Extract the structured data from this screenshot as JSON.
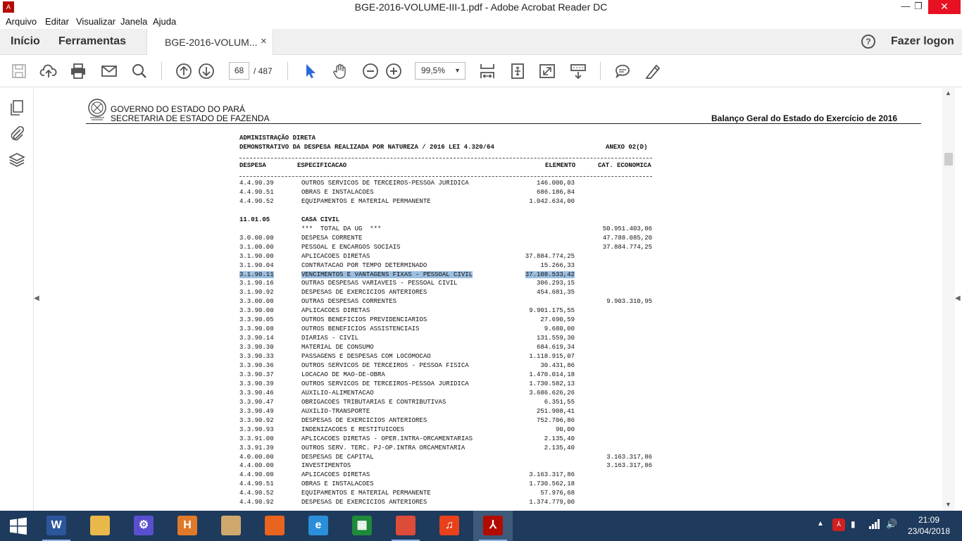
{
  "window": {
    "title": "BGE-2016-VOLUME-III-1.pdf - Adobe Acrobat Reader DC",
    "controls": {
      "minimize": "—",
      "maximize": "❐",
      "close": "✕"
    }
  },
  "menu": [
    "Arquivo",
    "Editar",
    "Visualizar",
    "Janela",
    "Ajuda"
  ],
  "tabs": {
    "home": "Início",
    "tools": "Ferramentas",
    "document": "BGE-2016-VOLUM...",
    "document_close": "×",
    "help": "?",
    "login": "Fazer logon"
  },
  "toolbar": {
    "page_current": "68",
    "page_total": "/ 487",
    "zoom": "99,5%",
    "zoom_arrow": "▼"
  },
  "document": {
    "header": {
      "gov": "GOVERNO DO ESTADO DO PARÁ",
      "secretaria": "SECRETARIA DE ESTADO DE FAZENDA",
      "report_title": "Balanço Geral do Estado do Exercício de 2016"
    },
    "section": {
      "line1": "ADMINISTRAÇÃO DIRETA",
      "line2": "DEMONSTRATIVO DA DESPESA REALIZADA POR NATUREZA / 2016 LEI 4.320/64",
      "annex": "ANEXO 02(D)"
    },
    "columns": {
      "despesa": "DESPESA",
      "especificacao": "ESPECIFICACAO",
      "elemento": "ELEMENTO",
      "cat_economica": "CAT. ECONOMICA"
    },
    "rows": [
      {
        "code": "4.4.90.39",
        "spec": "OUTROS SERVICOS DE TERCEIROS-PESSOA JURIDICA",
        "elem": "146.000,03",
        "cat": ""
      },
      {
        "code": "4.4.90.51",
        "spec": "OBRAS E INSTALACOES",
        "elem": "686.186,84",
        "cat": ""
      },
      {
        "code": "4.4.90.52",
        "spec": "EQUIPAMENTOS E MATERIAL PERMANENTE",
        "elem": "1.042.634,00",
        "cat": ""
      },
      {
        "code": "",
        "spec": "",
        "elem": "",
        "cat": ""
      },
      {
        "code": "11.01.05",
        "spec": "CASA CIVIL",
        "elem": "",
        "cat": "",
        "bold": true
      },
      {
        "code": "",
        "spec": "***  TOTAL DA UG  ***",
        "elem": "",
        "cat": "50.951.403,06"
      },
      {
        "code": "3.0.00.00",
        "spec": "DESPESA CORRENTE",
        "elem": "",
        "cat": "47.788.085,20"
      },
      {
        "code": "3.1.00.00",
        "spec": "PESSOAL E ENCARGOS SOCIAIS",
        "elem": "",
        "cat": "37.884.774,25"
      },
      {
        "code": "3.1.90.00",
        "spec": "APLICACOES DIRETAS",
        "elem": "37.884.774,25",
        "cat": ""
      },
      {
        "code": "3.1.90.04",
        "spec": "CONTRATACAO POR TEMPO DETERMINADO",
        "elem": "15.266,33",
        "cat": ""
      },
      {
        "code": "3.1.90.11",
        "spec": "VENCIMENTOS E VANTAGENS FIXAS - PESSOAL CIVIL",
        "elem": "37.108.533,42",
        "cat": "",
        "highlight": true
      },
      {
        "code": "3.1.90.16",
        "spec": "OUTRAS DESPESAS VARIAVEIS - PESSOAL CIVIL",
        "elem": "306.293,15",
        "cat": ""
      },
      {
        "code": "3.1.90.92",
        "spec": "DESPESAS DE EXERCICIOS ANTERIORES",
        "elem": "454.681,35",
        "cat": ""
      },
      {
        "code": "3.3.00.00",
        "spec": "OUTRAS DESPESAS CORRENTES",
        "elem": "",
        "cat": "9.903.310,95"
      },
      {
        "code": "3.3.90.00",
        "spec": "APLICACOES DIRETAS",
        "elem": "9.901.175,55",
        "cat": ""
      },
      {
        "code": "3.3.90.05",
        "spec": "OUTROS BENEFICIOS PREVIDENCIARIOS",
        "elem": "27.690,59",
        "cat": ""
      },
      {
        "code": "3.3.90.08",
        "spec": "OUTROS BENEFICIOS ASSISTENCIAIS",
        "elem": "9.680,00",
        "cat": ""
      },
      {
        "code": "3.3.90.14",
        "spec": "DIARIAS - CIVIL",
        "elem": "131.559,30",
        "cat": ""
      },
      {
        "code": "3.3.90.30",
        "spec": "MATERIAL DE CONSUMO",
        "elem": "684.619,34",
        "cat": ""
      },
      {
        "code": "3.3.90.33",
        "spec": "PASSAGENS E DESPESAS COM LOCOMOCAO",
        "elem": "1.118.915,07",
        "cat": ""
      },
      {
        "code": "3.3.90.36",
        "spec": "OUTROS SERVICOS DE TERCEIROS - PESSOA FISICA",
        "elem": "30.431,86",
        "cat": ""
      },
      {
        "code": "3.3.90.37",
        "spec": "LOCACAO DE MAO-DE-OBRA",
        "elem": "1.470.014,18",
        "cat": ""
      },
      {
        "code": "3.3.90.39",
        "spec": "OUTROS SERVICOS DE TERCEIROS-PESSOA JURIDICA",
        "elem": "1.730.582,13",
        "cat": ""
      },
      {
        "code": "3.3.90.46",
        "spec": "AUXILIO-ALIMENTACAO",
        "elem": "3.686.626,26",
        "cat": ""
      },
      {
        "code": "3.3.90.47",
        "spec": "OBRIGACOES TRIBUTARIAS E CONTRIBUTIVAS",
        "elem": "6.351,55",
        "cat": ""
      },
      {
        "code": "3.3.90.49",
        "spec": "AUXILIO-TRANSPORTE",
        "elem": "251.908,41",
        "cat": ""
      },
      {
        "code": "3.3.90.92",
        "spec": "DESPESAS DE EXERCICIOS ANTERIORES",
        "elem": "752.706,86",
        "cat": ""
      },
      {
        "code": "3.3.90.93",
        "spec": "INDENIZACOES E RESTITUICOES",
        "elem": "90,00",
        "cat": ""
      },
      {
        "code": "3.3.91.00",
        "spec": "APLICACOES DIRETAS - OPER.INTRA-ORCAMENTARIAS",
        "elem": "2.135,40",
        "cat": ""
      },
      {
        "code": "3.3.91.39",
        "spec": "OUTROS SERV. TERC. PJ-OP.INTRA ORCAMENTARIA",
        "elem": "2.135,40",
        "cat": ""
      },
      {
        "code": "4.0.00.00",
        "spec": "DESPESAS DE CAPITAL",
        "elem": "",
        "cat": "3.163.317,86"
      },
      {
        "code": "4.4.00.00",
        "spec": "INVESTIMENTOS",
        "elem": "",
        "cat": "3.163.317,86"
      },
      {
        "code": "4.4.90.00",
        "spec": "APLICACOES DIRETAS",
        "elem": "3.163.317,86",
        "cat": ""
      },
      {
        "code": "4.4.90.51",
        "spec": "OBRAS E INSTALACOES",
        "elem": "1.730.562,18",
        "cat": ""
      },
      {
        "code": "4.4.90.52",
        "spec": "EQUIPAMENTOS E MATERIAL PERMANENTE",
        "elem": "57.976,68",
        "cat": ""
      },
      {
        "code": "4.4.90.92",
        "spec": "DESPESAS DE EXERCICIOS ANTERIORES",
        "elem": "1.374.779,00",
        "cat": ""
      }
    ]
  },
  "taskbar": {
    "apps": [
      {
        "name": "word",
        "glyph": "W",
        "color": "#2b579a",
        "running": true
      },
      {
        "name": "file-explorer",
        "glyph": "",
        "color": "#e8b84a"
      },
      {
        "name": "settings",
        "glyph": "⚙",
        "color": "#5a4fcf"
      },
      {
        "name": "hypertext",
        "glyph": "H",
        "color": "#e07a2a"
      },
      {
        "name": "paint",
        "glyph": "",
        "color": "#cfa86e"
      },
      {
        "name": "firefox",
        "glyph": "",
        "color": "#e8641f"
      },
      {
        "name": "internet-explorer",
        "glyph": "e",
        "color": "#2a8fd8"
      },
      {
        "name": "calculator",
        "glyph": "▦",
        "color": "#1e8a3c"
      },
      {
        "name": "chrome",
        "glyph": "",
        "color": "#dd4b39",
        "running": true
      },
      {
        "name": "music",
        "glyph": "♫",
        "color": "#e8411c"
      },
      {
        "name": "acrobat",
        "glyph": "⅄",
        "color": "#b30b00",
        "running": true,
        "active": true
      }
    ],
    "clock_time": "21:09",
    "clock_date": "23/04/2018"
  }
}
